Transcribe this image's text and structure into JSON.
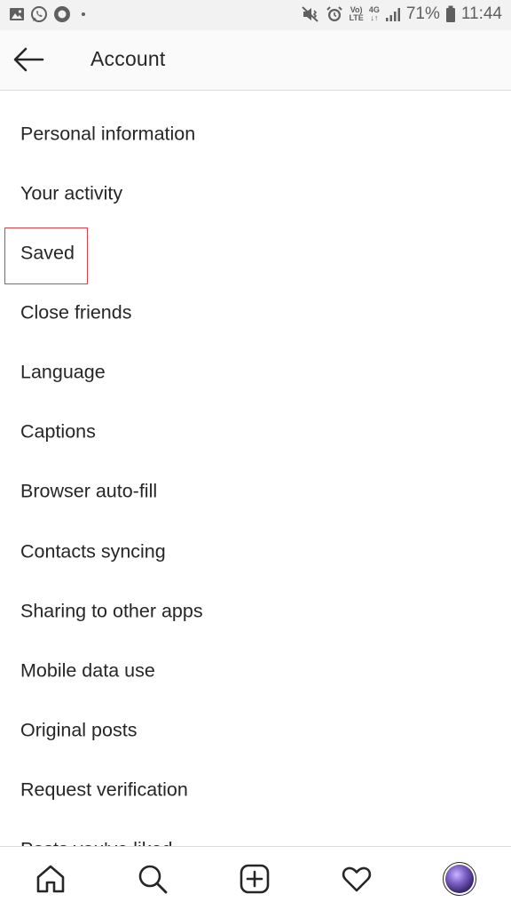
{
  "status_bar": {
    "left_icons": [
      "gallery-icon",
      "whatsapp-icon",
      "circle-app-icon",
      "dot-icon"
    ],
    "volte_line1": "Vo)",
    "volte_line2": "LTE",
    "network_line1": "4G",
    "network_line2": "↓↑",
    "battery_percent": "71%",
    "time": "11:44"
  },
  "header": {
    "title": "Account",
    "back_icon": "arrow-left-icon"
  },
  "menu": {
    "items": [
      {
        "label": "Personal information"
      },
      {
        "label": "Your activity"
      },
      {
        "label": "Saved"
      },
      {
        "label": "Close friends"
      },
      {
        "label": "Language"
      },
      {
        "label": "Captions"
      },
      {
        "label": "Browser auto-fill"
      },
      {
        "label": "Contacts syncing"
      },
      {
        "label": "Sharing to other apps"
      },
      {
        "label": "Mobile data use"
      },
      {
        "label": "Original posts"
      },
      {
        "label": "Request verification"
      },
      {
        "label": "Posts you've liked"
      }
    ],
    "highlighted_item": "Saved",
    "highlight_color": "#d0454c"
  },
  "bottom_nav": {
    "items": [
      "home-icon",
      "search-icon",
      "add-post-icon",
      "heart-icon",
      "profile-avatar"
    ]
  },
  "colors": {
    "text": "#262626",
    "status_bar_bg": "#f2f2f2",
    "header_bg": "#fafafa",
    "divider": "#dbdbdb"
  }
}
